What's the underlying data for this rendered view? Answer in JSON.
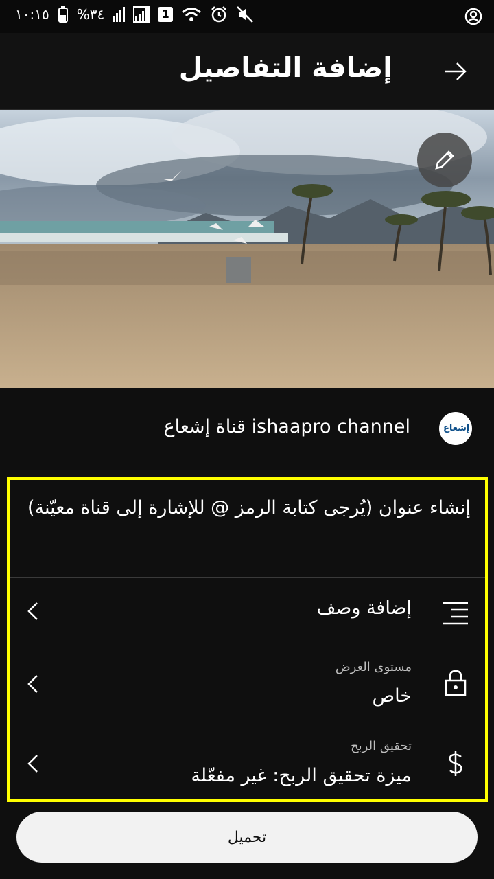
{
  "status_bar": {
    "time": "١٠:١٥",
    "battery": "%٣٤",
    "sim_badge": "1",
    "signal_r": "R"
  },
  "header": {
    "title": "إضافة التفاصيل"
  },
  "channel": {
    "name": "قناة إشعاع ishaapro channel",
    "avatar_text": "إشعاع"
  },
  "details": {
    "title_placeholder": "إنشاء عنوان (يُرجى كتابة الرمز @ للإشارة إلى قناة معيّنة)",
    "description_label": "إضافة وصف",
    "visibility_sub": "مستوى العرض",
    "visibility_value": "خاص",
    "monetization_sub": "تحقيق الربح",
    "monetization_value": "ميزة تحقيق الربح: غير مفعّلة"
  },
  "upload_button": "تحميل",
  "colors": {
    "highlight": "#ffff00",
    "background": "#0f0f0f",
    "button_bg": "#f2f2f2"
  },
  "icons": [
    "back-arrow-icon",
    "pencil-icon",
    "description-lines-icon",
    "lock-icon",
    "dollar-icon",
    "chevron-left-icon",
    "account-icon"
  ]
}
